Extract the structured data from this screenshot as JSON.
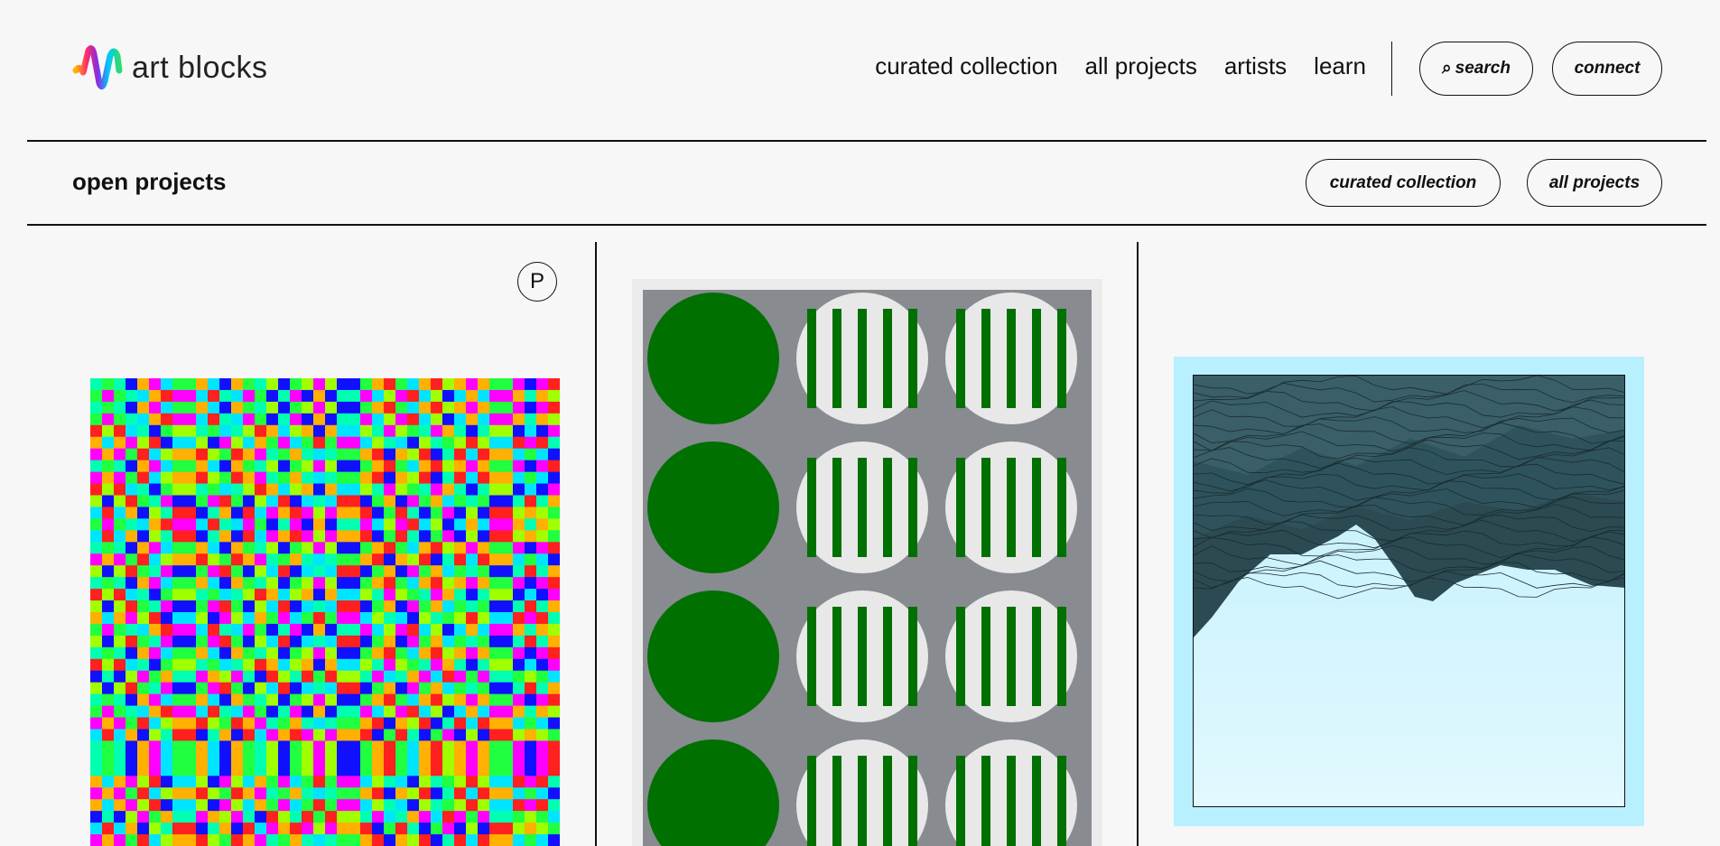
{
  "header": {
    "logo_text": "art blocks",
    "nav": [
      "curated collection",
      "all projects",
      "artists",
      "learn"
    ],
    "search_label": "search",
    "connect_label": "connect"
  },
  "subheader": {
    "title": "open projects",
    "filters": [
      "curated collection",
      "all projects"
    ]
  },
  "projects": [
    {
      "badge": "P",
      "thumbnail": "colorful pixel plaid grid"
    },
    {
      "thumbnail": "green circles on grey pixel field"
    },
    {
      "thumbnail": "dark teal layered mountain over light cyan"
    }
  ],
  "colors": {
    "background": "#f7f7f7",
    "text": "#111111",
    "art3_frame": "#b8f0ff",
    "art2_green": "#007000",
    "art2_grey": "#888b90"
  }
}
